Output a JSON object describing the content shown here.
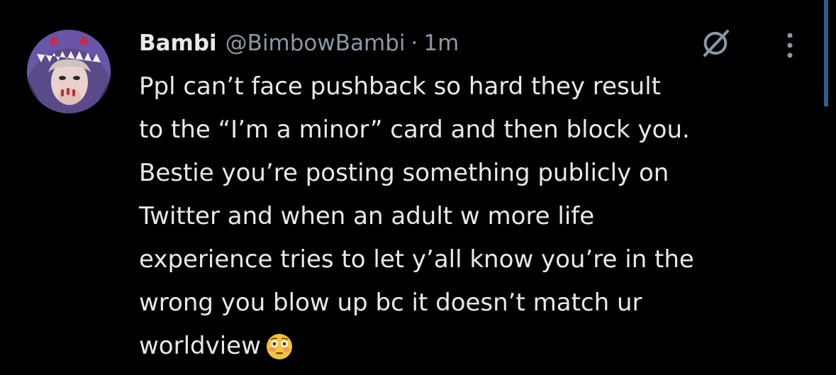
{
  "tweet": {
    "display_name": "Bambi",
    "handle": "@BimbowBambi",
    "separator": "·",
    "time": "1m",
    "lines": [
      "Ppl can’t face pushback so hard they result",
      "to the “I’m a minor” card and then block you.",
      "Bestie you’re posting something publicly on",
      "Twitter and when an adult w more life",
      "experience tries to let y’all know you’re in the",
      "wrong you blow up bc it doesn’t match ur",
      "worldview"
    ],
    "emoji": "flushed-face"
  },
  "icons": {
    "grok": "grok-icon",
    "more": "more-vertical-icon",
    "avatar": "avatar"
  },
  "colors": {
    "background": "#000000",
    "text": "#e7e9ea",
    "secondary_text": "#8b98a5",
    "scroll_accent": "#2f5f8a"
  }
}
